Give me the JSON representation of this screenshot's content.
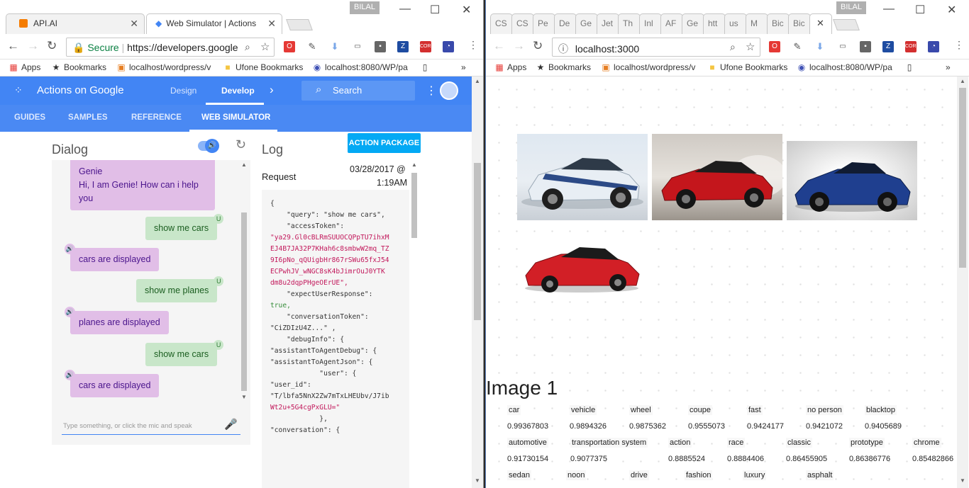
{
  "left_window": {
    "user": "BILAL",
    "tabs": [
      {
        "title": "API.AI",
        "active": false
      },
      {
        "title": "Web Simulator  |  Actions",
        "active": true
      }
    ],
    "url_secure": "Secure",
    "url": "https://developers.google",
    "bookmarks": {
      "apps": "Apps",
      "items": [
        "Bookmarks",
        "localhost/wordpress/v",
        "Ufone Bookmarks",
        "localhost:8080/WP/pa"
      ]
    },
    "aog": {
      "brand": "Actions on Google",
      "nav": [
        "Design",
        "Develop"
      ],
      "search": "Search",
      "subnav": [
        "GUIDES",
        "SAMPLES",
        "REFERENCE",
        "WEB SIMULATOR"
      ],
      "action_package": "ACTION PACKAGE",
      "dialog_title": "Dialog",
      "log_title": "Log",
      "request_label": "Request",
      "request_date": "03/28/2017 @",
      "request_time": "1:19AM",
      "messages": [
        {
          "from": "bot",
          "title": "Genie",
          "text": "Hi, I am Genie! How can i help you"
        },
        {
          "from": "user",
          "text": "show me cars"
        },
        {
          "from": "bot",
          "text": "cars are displayed"
        },
        {
          "from": "user",
          "text": "show me planes"
        },
        {
          "from": "bot",
          "text": "planes are displayed"
        },
        {
          "from": "user",
          "text": "show me cars"
        },
        {
          "from": "bot",
          "text": "cars are displayed"
        }
      ],
      "input_placeholder": "Type something, or click the mic and speak",
      "code_lines": [
        "{",
        "    \"query\": \"show me cars\",",
        "    \"accessToken\":",
        "\"ya29.Gl0cBLRmSUUOCQPpTU7ihxM",
        "EJ4B7JA32P7KHah6c8smbwW2mq_TZ",
        "9I6pNo_qQUigbHr867rSWu65fxJ54",
        "ECPwhJV_wNGC8sK4bJimrOuJ0YTK",
        "dm8u2dqpPHgeOErUE\",",
        "    \"expectUserResponse\":",
        "true,",
        "    \"conversationToken\":",
        "\"CiZDIzU4Z...\" ,",
        "    \"debugInfo\": {",
        "",
        "\"assistantToAgentDebug\": {",
        "",
        "\"assistantToAgentJson\": {",
        "            \"user\": {",
        "",
        "\"user_id\":",
        "\"T/lbfa5NnX2Zw7mTxLHEUbv/J7ib",
        "Wt2u+5G4cgPxGLU=\"",
        "            },",
        "",
        "\"conversation\": {"
      ]
    }
  },
  "right_window": {
    "user": "BILAL",
    "tabs": [
      "CS",
      "CS",
      "Pe",
      "De",
      "Ge",
      "Jet",
      "Th",
      "Inl",
      "AF",
      "Ge",
      "htt",
      "us",
      "M",
      "Bic",
      "Bic",
      ""
    ],
    "url": "localhost:3000",
    "bookmarks": {
      "apps": "Apps",
      "items": [
        "Bookmarks",
        "localhost/wordpress/v",
        "Ufone Bookmarks",
        "localhost:8080/WP/pa"
      ]
    },
    "image_heading": "Image 1",
    "tag_rows": [
      [
        {
          "label": "car",
          "score": "0.99367803"
        },
        {
          "label": "vehicle",
          "score": "0.9894326"
        },
        {
          "label": "wheel",
          "score": "0.9875362"
        },
        {
          "label": "coupe",
          "score": "0.9555073"
        },
        {
          "label": "fast",
          "score": "0.9424177"
        },
        {
          "label": "no person",
          "score": "0.9421072"
        },
        {
          "label": "blacktop",
          "score": "0.9405689"
        }
      ],
      [
        {
          "label": "automotive",
          "score": "0.91730154"
        },
        {
          "label": "transportation system",
          "score": "0.9077375"
        },
        {
          "label": "action",
          "score": "0.8885524"
        },
        {
          "label": "race",
          "score": "0.8884406"
        },
        {
          "label": "classic",
          "score": "0.86455905"
        },
        {
          "label": "prototype",
          "score": "0.86386776"
        },
        {
          "label": "chrome",
          "score": "0.85482866"
        }
      ],
      [
        {
          "label": "sedan",
          "score": ""
        },
        {
          "label": "noon",
          "score": ""
        },
        {
          "label": "drive",
          "score": ""
        },
        {
          "label": "fashion",
          "score": ""
        },
        {
          "label": "luxury",
          "score": ""
        },
        {
          "label": "asphalt",
          "score": ""
        }
      ]
    ]
  }
}
